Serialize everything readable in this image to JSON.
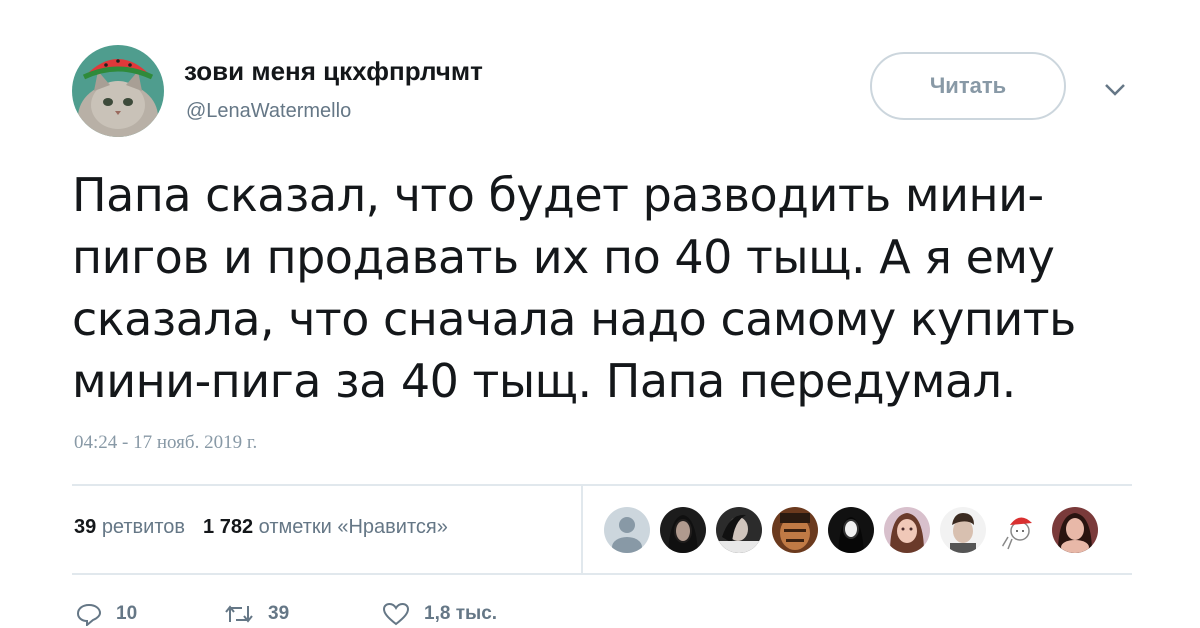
{
  "author": {
    "display_name": "зови меня цкхфпрлчмт",
    "handle": "@LenaWatermello",
    "avatar_icon": "cat-with-watermelon-hat-avatar"
  },
  "follow_button": {
    "label": "Читать"
  },
  "menu_caret_icon": "chevron-down-icon",
  "tweet": {
    "lines": [
      "Папа сказал, что будет разводить мини-",
      "пигов и продавать их по 40 тыщ. А я ему",
      "сказала, что сначала надо самому купить",
      "мини-пига за 40 тыщ. Папа передумал."
    ],
    "timestamp": "04:24 - 17 нояб. 2019 г."
  },
  "stats": {
    "retweets_count": "39",
    "retweets_label": "ретвитов",
    "likes_count": "1 782",
    "likes_label": "отметки «Нравится»"
  },
  "likers": [
    {
      "icon": "default-avatar-icon"
    },
    {
      "icon": "user-avatar-icon"
    },
    {
      "icon": "user-avatar-icon"
    },
    {
      "icon": "user-avatar-icon"
    },
    {
      "icon": "user-avatar-icon"
    },
    {
      "icon": "user-avatar-icon"
    },
    {
      "icon": "user-avatar-icon"
    },
    {
      "icon": "user-avatar-icon"
    },
    {
      "icon": "user-avatar-icon"
    }
  ],
  "actions": {
    "reply_count": "10",
    "retweet_count": "39",
    "like_count": "1,8 тыс."
  },
  "colors": {
    "text": "#14171a",
    "secondary": "#657786",
    "muted": "#8899a6",
    "border": "#e1e8ed"
  }
}
